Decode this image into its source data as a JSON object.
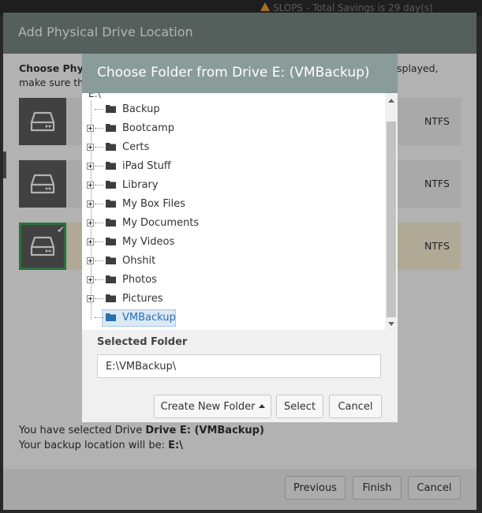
{
  "app": {
    "status_text": "SLOPS - Total Savings is 29 day(s)"
  },
  "outer_dialog": {
    "title": "Add Physical Drive Location",
    "intro_bold": "Choose Phys",
    "intro_rest": "",
    "intro_line2": "make sure th",
    "intro_right": "splayed,",
    "drives": [
      {
        "fs": "NTFS",
        "selected": false
      },
      {
        "fs": "NTFS",
        "selected": false
      },
      {
        "fs": "NTFS",
        "selected": true
      }
    ],
    "summary_line1_prefix": "You have selected Drive ",
    "summary_line1_bold": "Drive E: (VMBackup)",
    "summary_line2_prefix": "Your backup location will be: ",
    "summary_line2_bold": "E:\\",
    "buttons": {
      "previous": "Previous",
      "finish": "Finish",
      "cancel": "Cancel"
    }
  },
  "folder_dialog": {
    "title": "Choose Folder from Drive E: (VMBackup)",
    "root_label": "E:\\",
    "folders": [
      {
        "name": "Backup",
        "expandable": false,
        "selected": false
      },
      {
        "name": "Bootcamp",
        "expandable": true,
        "selected": false
      },
      {
        "name": "Certs",
        "expandable": true,
        "selected": false
      },
      {
        "name": "iPad Stuff",
        "expandable": true,
        "selected": false
      },
      {
        "name": "Library",
        "expandable": true,
        "selected": false
      },
      {
        "name": "My Box Files",
        "expandable": true,
        "selected": false
      },
      {
        "name": "My Documents",
        "expandable": true,
        "selected": false
      },
      {
        "name": "My Videos",
        "expandable": true,
        "selected": false
      },
      {
        "name": "Ohshit",
        "expandable": true,
        "selected": false
      },
      {
        "name": "Photos",
        "expandable": true,
        "selected": false
      },
      {
        "name": "Pictures",
        "expandable": true,
        "selected": false
      },
      {
        "name": "VMBackup",
        "expandable": false,
        "selected": true
      }
    ],
    "selected_folder_label": "Selected Folder",
    "selected_folder_value": "E:\\VMBackup\\",
    "buttons": {
      "create_new_folder": "Create New Folder",
      "select": "Select",
      "cancel": "Cancel"
    }
  },
  "colors": {
    "accent_green": "#3aa35a",
    "title_bar": "#8a9c98",
    "selection": "#dbe9f5"
  }
}
